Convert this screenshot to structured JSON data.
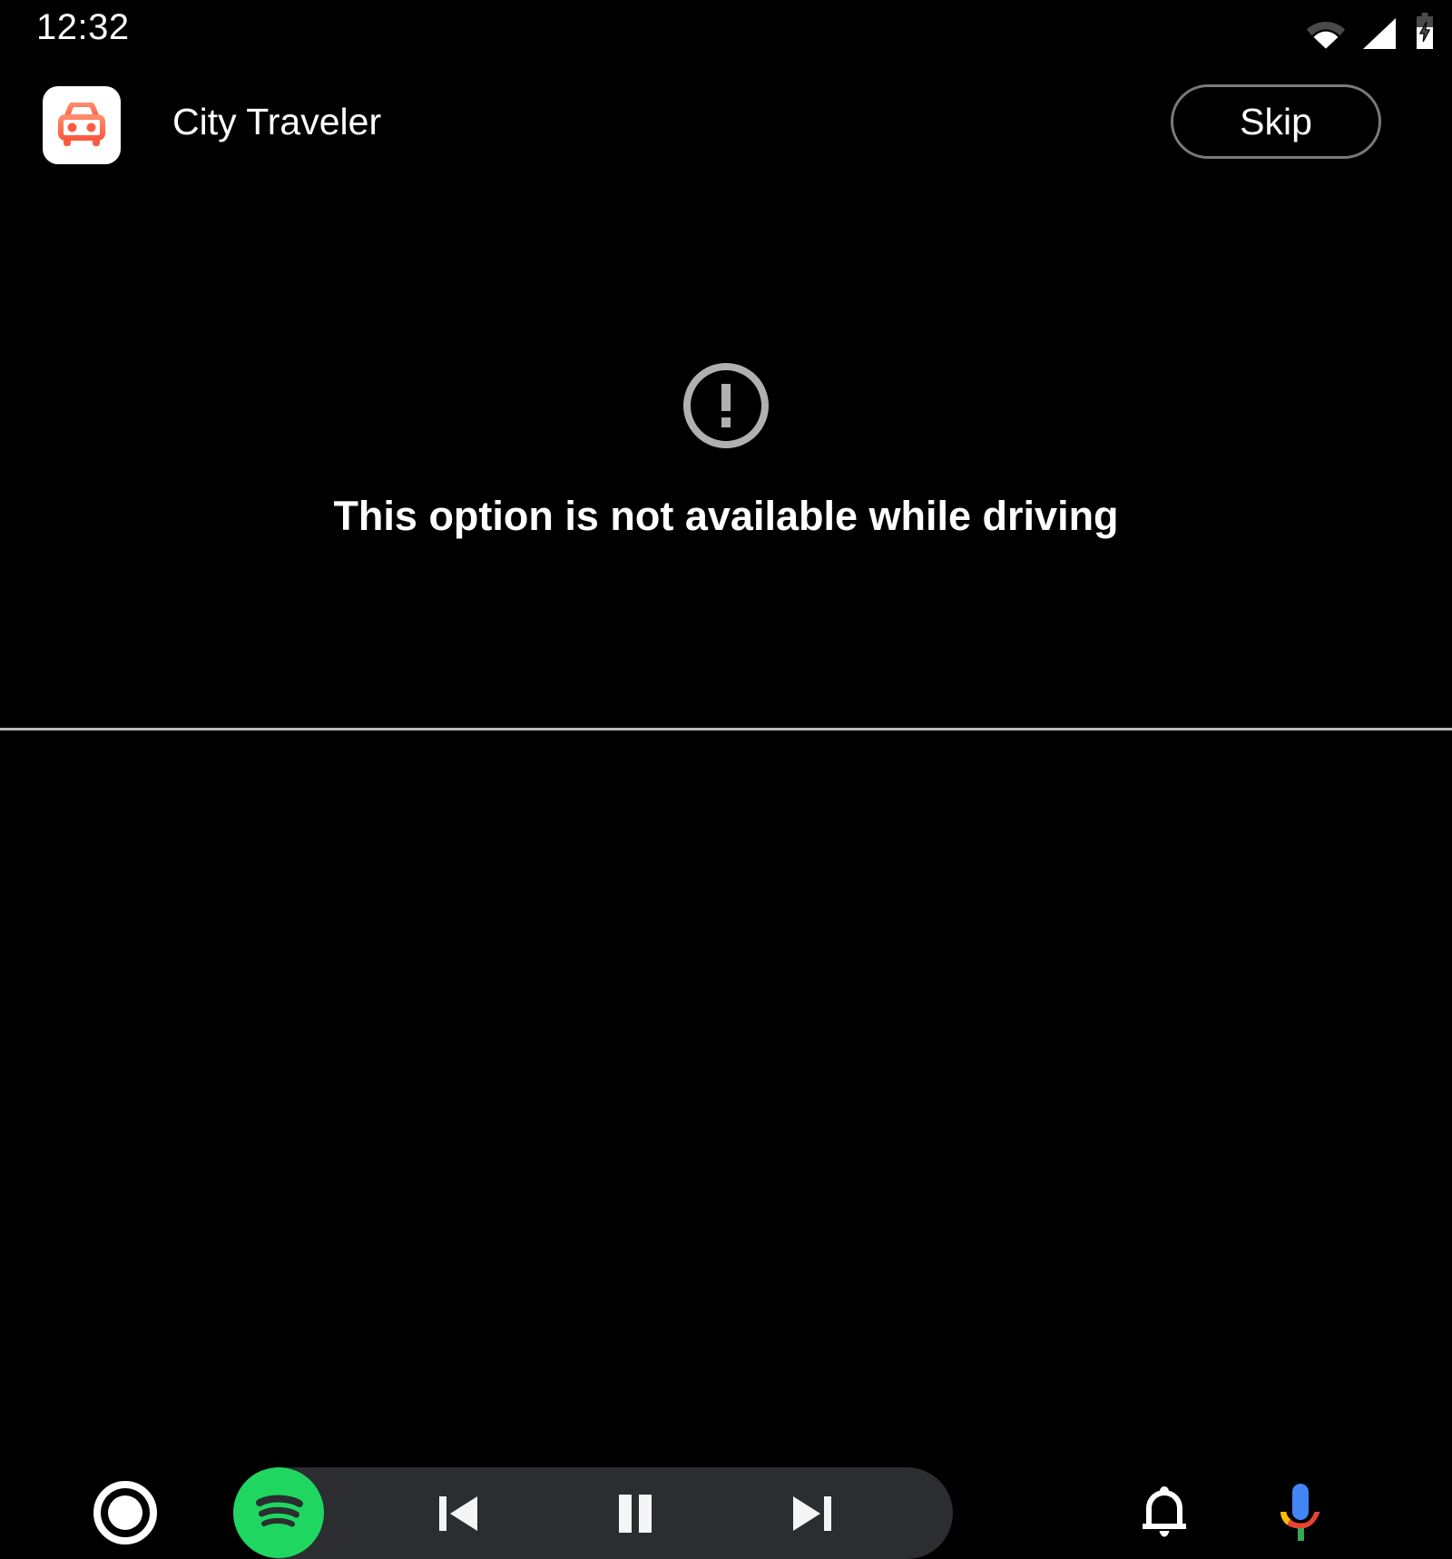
{
  "status_bar": {
    "clock": "12:32",
    "icons": [
      {
        "name": "wifi-icon",
        "label": "Wi-Fi"
      },
      {
        "name": "cell-signal-icon",
        "label": "Mobile signal"
      },
      {
        "name": "battery-charging-icon",
        "label": "Battery charging"
      }
    ]
  },
  "header": {
    "app_icon_name": "car-app-icon",
    "app_title": "City Traveler",
    "skip_label": "Skip",
    "icon_accent_color": "#FF6F52",
    "icon_background_color": "#FFFFFF",
    "skip_border_color": "#7A7A7A"
  },
  "content": {
    "error_icon_name": "error-exclamation-circle-icon",
    "error_icon_color": "#B0B0B0",
    "message": "This option is not available while driving"
  },
  "nav_bar": {
    "home_label": "Home",
    "media_app": "Spotify",
    "media_app_color": "#1FD760",
    "pill_color": "#2B2D30",
    "divider_color": "#B9B9B9",
    "controls": [
      {
        "name": "skip-previous-button",
        "label": "Previous"
      },
      {
        "name": "pause-button",
        "label": "Pause"
      },
      {
        "name": "skip-next-button",
        "label": "Next"
      }
    ],
    "notifications_label": "Notifications",
    "assistant_label": "Google Assistant"
  }
}
